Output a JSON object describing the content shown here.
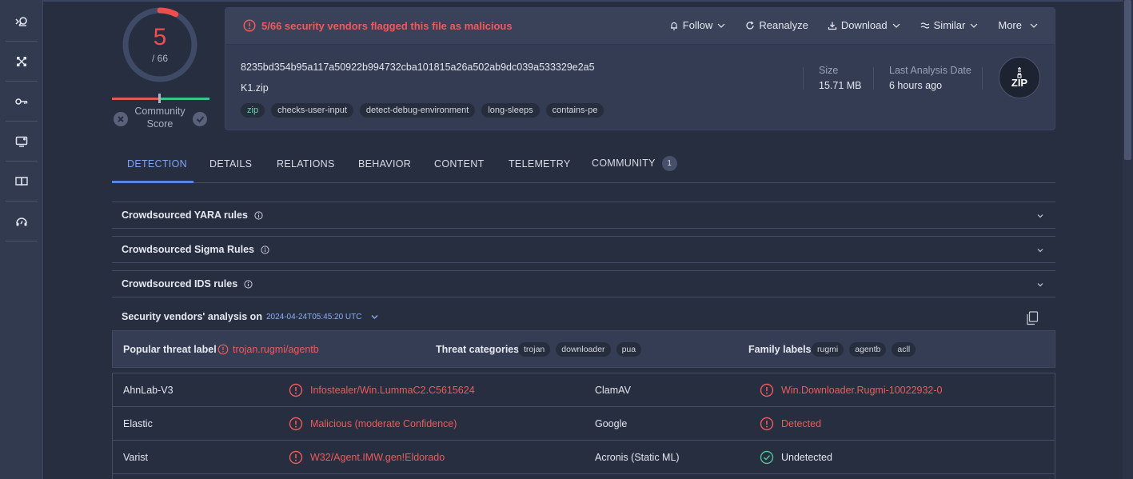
{
  "rail": {
    "items": [
      {
        "icon": "search-file-icon"
      },
      {
        "icon": "graph-icon"
      },
      {
        "icon": "key-icon"
      },
      {
        "icon": "monitor-icon"
      },
      {
        "icon": "book-icon"
      },
      {
        "icon": "help-icon"
      }
    ]
  },
  "score": {
    "detections": "5",
    "total": "/ 66",
    "fraction": 0.0758,
    "color": "#ef4e4e",
    "community_label": "Community Score"
  },
  "header": {
    "alert": "5/66 security vendors flagged this file as malicious",
    "actions": [
      "Follow",
      "Reanalyze",
      "Download",
      "Similar",
      "More"
    ],
    "hash": "8235bd354b95a117a50922b994732cba101815a26a502ab9dc039a533329e2a5",
    "filename": "K1.zip",
    "tags": [
      "zip",
      "checks-user-input",
      "detect-debug-environment",
      "long-sleeps",
      "contains-pe"
    ],
    "size_label": "Size",
    "size_value": "15.71 MB",
    "date_label": "Last Analysis Date",
    "date_value": "6 hours ago",
    "filetype_badge": "ZIP"
  },
  "tabs": [
    {
      "label": "DETECTION",
      "active": true
    },
    {
      "label": "DETAILS"
    },
    {
      "label": "RELATIONS"
    },
    {
      "label": "BEHAVIOR"
    },
    {
      "label": "CONTENT"
    },
    {
      "label": "TELEMETRY"
    },
    {
      "label": "COMMUNITY",
      "count": "1"
    }
  ],
  "sections": [
    {
      "title": "Crowdsourced YARA rules"
    },
    {
      "title": "Crowdsourced Sigma Rules"
    },
    {
      "title": "Crowdsourced IDS rules"
    }
  ],
  "analysis": {
    "title": "Security vendors' analysis on",
    "date": "2024-04-24T05:45:20 UTC"
  },
  "threat": {
    "popular_label": "Popular threat label",
    "popular_value": "trojan.rugmi/agentb",
    "categories_label": "Threat categories",
    "categories": [
      "trojan",
      "downloader",
      "pua"
    ],
    "family_label": "Family labels",
    "families": [
      "rugmi",
      "agentb",
      "acll"
    ]
  },
  "vendors": [
    {
      "left_name": "AhnLab-V3",
      "left_result": "Infostealer/Win.LummaC2.C5615624",
      "left_status": "malicious",
      "right_name": "ClamAV",
      "right_result": "Win.Downloader.Rugmi-10022932-0",
      "right_status": "malicious"
    },
    {
      "left_name": "Elastic",
      "left_result": "Malicious (moderate Confidence)",
      "left_status": "malicious",
      "right_name": "Google",
      "right_result": "Detected",
      "right_status": "malicious"
    },
    {
      "left_name": "Varist",
      "left_result": "W32/Agent.IMW.gen!Eldorado",
      "left_status": "malicious",
      "right_name": "Acronis (Static ML)",
      "right_result": "Undetected",
      "right_status": "clean"
    }
  ]
}
